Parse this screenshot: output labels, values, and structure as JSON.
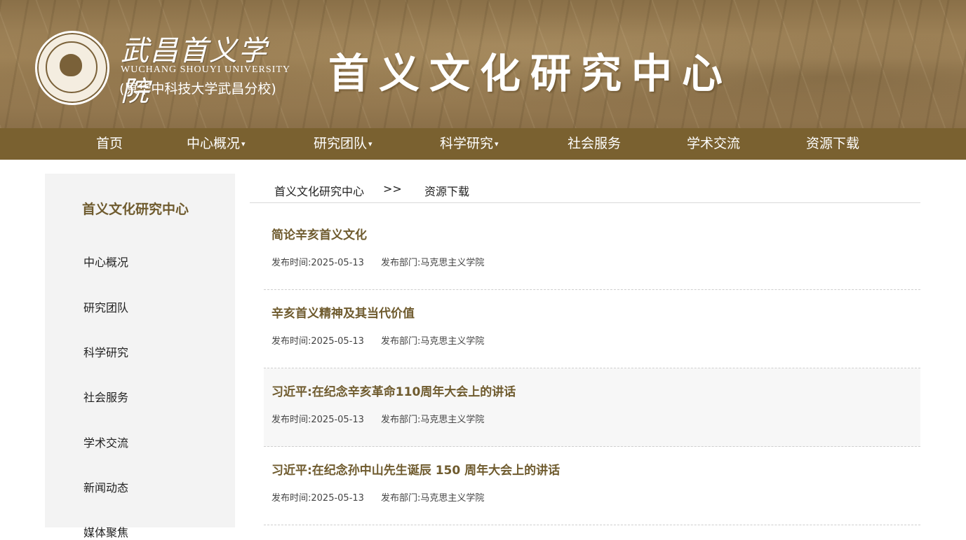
{
  "header": {
    "school_name_cn": "武昌首义学院",
    "school_name_en": "WUCHANG SHOUYI UNIVERSITY",
    "school_former": "(原华中科技大学武昌分校)",
    "site_title": "首义文化研究中心",
    "seal_text": "WUCHANG SHOUYI UNIVERSITY"
  },
  "nav": {
    "items": [
      {
        "label": "首页",
        "dropdown": false
      },
      {
        "label": "中心概况",
        "dropdown": true
      },
      {
        "label": "研究团队",
        "dropdown": true
      },
      {
        "label": "科学研究",
        "dropdown": true
      },
      {
        "label": "社会服务",
        "dropdown": false
      },
      {
        "label": "学术交流",
        "dropdown": false
      },
      {
        "label": "资源下载",
        "dropdown": false
      }
    ],
    "caret": "▾"
  },
  "sidebar": {
    "title": "首义文化研究中心",
    "items": [
      {
        "label": "中心概况"
      },
      {
        "label": "研究团队"
      },
      {
        "label": "科学研究"
      },
      {
        "label": "社会服务"
      },
      {
        "label": "学术交流"
      },
      {
        "label": "新闻动态"
      },
      {
        "label": "媒体聚焦"
      }
    ]
  },
  "breadcrumb": {
    "root": "首义文化研究中心",
    "separator": ">>",
    "current": "资源下载"
  },
  "articles": [
    {
      "title": "简论辛亥首义文化",
      "time_label": "发布时间:",
      "date": "2025-05-13",
      "dept_label": "发布部门:",
      "dept": "马克思主义学院"
    },
    {
      "title": "辛亥首义精神及其当代价值",
      "time_label": "发布时间:",
      "date": "2025-05-13",
      "dept_label": "发布部门:",
      "dept": "马克思主义学院"
    },
    {
      "title": "习近平:在纪念辛亥革命110周年大会上的讲话",
      "time_label": "发布时间:",
      "date": "2025-05-13",
      "dept_label": "发布部门:",
      "dept": "马克思主义学院"
    },
    {
      "title": "习近平:在纪念孙中山先生诞辰 150 周年大会上的讲话",
      "time_label": "发布时间:",
      "date": "2025-05-13",
      "dept_label": "发布部门:",
      "dept": "马克思主义学院"
    }
  ],
  "colors": {
    "nav_bg": "#7a6130",
    "accent_text": "#6f5b2e",
    "sidebar_bg": "#f3f3f3"
  }
}
